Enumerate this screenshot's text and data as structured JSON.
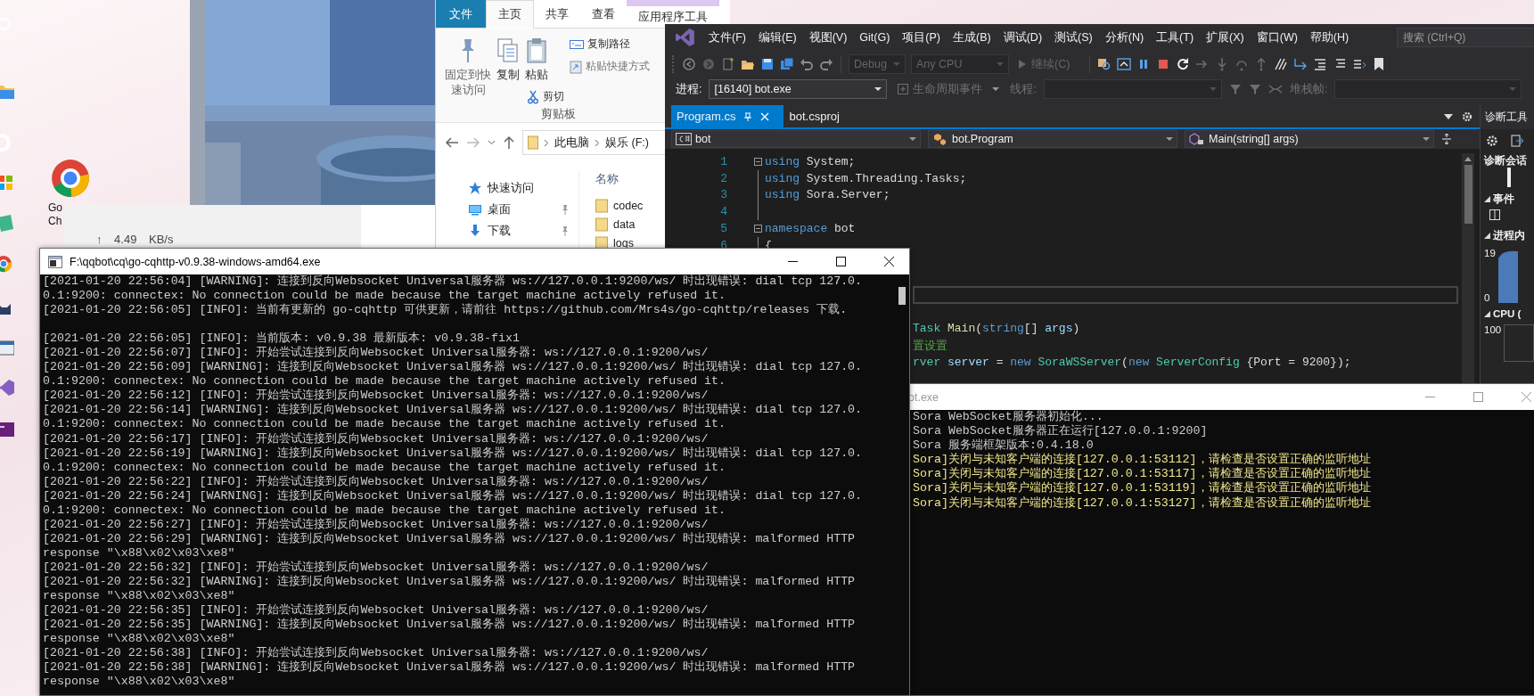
{
  "desktop": {
    "icon_label_lines": [
      "Go",
      "Ch"
    ]
  },
  "network_widget": {
    "text": "↑ 4.49 KB/s"
  },
  "explorer": {
    "tabs": [
      {
        "label": "文件",
        "kind": "file",
        "selected": false
      },
      {
        "label": "主页",
        "kind": "tab",
        "selected": true
      },
      {
        "label": "共享",
        "kind": "tab",
        "selected": false
      },
      {
        "label": "查看",
        "kind": "tab",
        "selected": false
      },
      {
        "label": "应用程序工具",
        "kind": "context",
        "selected": false
      }
    ],
    "ribbon": {
      "pin": "固定到快速访问",
      "copy": "复制",
      "paste": "粘贴",
      "cut": "剪切",
      "copy_path": "复制路径",
      "paste_shortcut": "粘贴快捷方式",
      "group": "剪贴板"
    },
    "address": [
      "此电脑",
      "娱乐 (F:)"
    ],
    "nav_items": [
      {
        "label": "快速访问",
        "kind": "star",
        "pinned": false
      },
      {
        "label": "桌面",
        "kind": "desktop",
        "pinned": true
      },
      {
        "label": "下载",
        "kind": "download",
        "pinned": true
      }
    ],
    "column": "名称",
    "files": [
      "codec",
      "data",
      "logs"
    ]
  },
  "visual_studio": {
    "menus": [
      "文件(F)",
      "编辑(E)",
      "视图(V)",
      "Git(G)",
      "项目(P)",
      "生成(B)",
      "调试(D)",
      "测试(S)",
      "分析(N)",
      "工具(T)",
      "扩展(X)",
      "窗口(W)",
      "帮助(H)"
    ],
    "search": {
      "placeholder": "搜索 (Ctrl+Q)"
    },
    "toolbar": {
      "configuration": {
        "value": "Debug",
        "disabled": true
      },
      "platform": {
        "value": "Any CPU",
        "disabled": true
      },
      "continue": {
        "label": "继续(C)",
        "disabled": true
      }
    },
    "debug_bar": [
      {
        "kind": "label",
        "text": "进程:",
        "disabled": false
      },
      {
        "kind": "dropdown",
        "value": "[16140] bot.exe",
        "disabled": false
      },
      {
        "kind": "button",
        "text": "生命周期事件",
        "disabled": true
      },
      {
        "kind": "label",
        "text": "线程:",
        "disabled": true
      },
      {
        "kind": "dropdown",
        "disabled": true
      },
      {
        "kind": "filters",
        "disabled": true
      },
      {
        "kind": "label",
        "text": "堆栈帧:",
        "disabled": true
      },
      {
        "kind": "dropdown",
        "disabled": true
      }
    ],
    "doc_tabs": [
      {
        "label": "Program.cs",
        "selected": true
      },
      {
        "label": "bot.csproj",
        "selected": false
      }
    ],
    "nav_bar": [
      "bot",
      "bot.Program",
      "Main(string[] args)"
    ],
    "editor": {
      "lines": [
        {
          "number": "1",
          "fold": true,
          "tokens": [
            {
              "text": "using",
              "kind": "keyword"
            },
            {
              "text": " System;",
              "kind": "plain"
            }
          ]
        },
        {
          "number": "2",
          "fold": false,
          "tokens": [
            {
              "text": "using",
              "kind": "keyword"
            },
            {
              "text": " System.Threading.Tasks;",
              "kind": "plain"
            }
          ]
        },
        {
          "number": "3",
          "fold": false,
          "tokens": [
            {
              "text": "using",
              "kind": "keyword"
            },
            {
              "text": " Sora.Server;",
              "kind": "plain"
            }
          ]
        },
        {
          "number": "4",
          "fold": false
        },
        {
          "number": "5",
          "fold": true,
          "tokens": [
            {
              "text": "namespace",
              "kind": "keyword"
            },
            {
              "text": " bot",
              "kind": "plain"
            }
          ]
        },
        {
          "number": "6",
          "fold": false,
          "tokens": [
            {
              "text": "{",
              "kind": "plain"
            }
          ]
        }
      ],
      "current_line": true,
      "partial_lines": [
        {
          "tokens": [
            {
              "text": "Task",
              "kind": "type"
            },
            {
              "text": " Main",
              "kind": "method"
            },
            {
              "text": "(",
              "kind": "plain"
            },
            {
              "text": "string",
              "kind": "keyword"
            },
            {
              "text": "[] ",
              "kind": "plain"
            },
            {
              "text": "args",
              "kind": "param"
            },
            {
              "text": ")",
              "kind": "plain"
            }
          ]
        },
        {
          "tokens": [
            {
              "text": "置设置",
              "kind": "comment"
            }
          ]
        },
        {
          "tokens": [
            {
              "text": "rver",
              "kind": "type"
            },
            {
              "text": " server",
              "kind": "param"
            },
            {
              "text": " = ",
              "kind": "plain"
            },
            {
              "text": "new",
              "kind": "keyword"
            },
            {
              "text": " SoraWSServer",
              "kind": "type"
            },
            {
              "text": "(",
              "kind": "plain"
            },
            {
              "text": "new",
              "kind": "keyword"
            },
            {
              "text": " ServerConfig",
              "kind": "type"
            },
            {
              "text": " {Port = 9200});",
              "kind": "plain"
            }
          ]
        }
      ]
    },
    "diagnostics": {
      "title": "诊断工具",
      "session": "诊断会话",
      "events": "事件",
      "memory": "进程内",
      "memory_ticks": [
        "19",
        "0"
      ],
      "cpu": "CPU (",
      "cpu_ticks": [
        "100"
      ]
    }
  },
  "console_go": {
    "title": "F:\\qqbot\\cq\\go-cqhttp-v0.9.38-windows-amd64.exe",
    "lines": [
      {
        "text": "[2021-01-20 22:56:04] [WARNING]: 连接到反向Websocket Universal服务器 ws://127.0.0.1:9200/ws/ 时出现错误: dial tcp 127.0."
      },
      {
        "text": "0.1:9200: connectex: No connection could be made because the target machine actively refused it."
      },
      {
        "text": "[2021-01-20 22:56:05] [INFO]: 当前有更新的 go-cqhttp 可供更新，请前往 https://github.com/Mrs4s/go-cqhttp/releases 下载."
      },
      {
        "text": "[2021-01-20 22:56:05] [INFO]: 当前版本: v0.9.38 最新版本: v0.9.38-fix1",
        "blank_before": true
      },
      {
        "text": "[2021-01-20 22:56:07] [INFO]: 开始尝试连接到反向Websocket Universal服务器: ws://127.0.0.1:9200/ws/"
      },
      {
        "text": "[2021-01-20 22:56:09] [WARNING]: 连接到反向Websocket Universal服务器 ws://127.0.0.1:9200/ws/ 时出现错误: dial tcp 127.0."
      },
      {
        "text": "0.1:9200: connectex: No connection could be made because the target machine actively refused it."
      },
      {
        "text": "[2021-01-20 22:56:12] [INFO]: 开始尝试连接到反向Websocket Universal服务器: ws://127.0.0.1:9200/ws/"
      },
      {
        "text": "[2021-01-20 22:56:14] [WARNING]: 连接到反向Websocket Universal服务器 ws://127.0.0.1:9200/ws/ 时出现错误: dial tcp 127.0."
      },
      {
        "text": "0.1:9200: connectex: No connection could be made because the target machine actively refused it."
      },
      {
        "text": "[2021-01-20 22:56:17] [INFO]: 开始尝试连接到反向Websocket Universal服务器: ws://127.0.0.1:9200/ws/"
      },
      {
        "text": "[2021-01-20 22:56:19] [WARNING]: 连接到反向Websocket Universal服务器 ws://127.0.0.1:9200/ws/ 时出现错误: dial tcp 127.0."
      },
      {
        "text": "0.1:9200: connectex: No connection could be made because the target machine actively refused it."
      },
      {
        "text": "[2021-01-20 22:56:22] [INFO]: 开始尝试连接到反向Websocket Universal服务器: ws://127.0.0.1:9200/ws/"
      },
      {
        "text": "[2021-01-20 22:56:24] [WARNING]: 连接到反向Websocket Universal服务器 ws://127.0.0.1:9200/ws/ 时出现错误: dial tcp 127.0."
      },
      {
        "text": "0.1:9200: connectex: No connection could be made because the target machine actively refused it."
      },
      {
        "text": "[2021-01-20 22:56:27] [INFO]: 开始尝试连接到反向Websocket Universal服务器: ws://127.0.0.1:9200/ws/"
      },
      {
        "text": "[2021-01-20 22:56:29] [WARNING]: 连接到反向Websocket Universal服务器 ws://127.0.0.1:9200/ws/ 时出现错误: malformed HTTP"
      },
      {
        "text": "response \"\\x88\\x02\\x03\\xe8\""
      },
      {
        "text": "[2021-01-20 22:56:32] [INFO]: 开始尝试连接到反向Websocket Universal服务器: ws://127.0.0.1:9200/ws/"
      },
      {
        "text": "[2021-01-20 22:56:32] [WARNING]: 连接到反向Websocket Universal服务器 ws://127.0.0.1:9200/ws/ 时出现错误: malformed HTTP"
      },
      {
        "text": "response \"\\x88\\x02\\x03\\xe8\""
      },
      {
        "text": "[2021-01-20 22:56:35] [INFO]: 开始尝试连接到反向Websocket Universal服务器: ws://127.0.0.1:9200/ws/"
      },
      {
        "text": "[2021-01-20 22:56:35] [WARNING]: 连接到反向Websocket Universal服务器 ws://127.0.0.1:9200/ws/ 时出现错误: malformed HTTP"
      },
      {
        "text": "response \"\\x88\\x02\\x03\\xe8\""
      },
      {
        "text": "[2021-01-20 22:56:38] [INFO]: 开始尝试连接到反向Websocket Universal服务器: ws://127.0.0.1:9200/ws/"
      },
      {
        "text": "[2021-01-20 22:56:38] [WARNING]: 连接到反向Websocket Universal服务器 ws://127.0.0.1:9200/ws/ 时出现错误: malformed HTTP"
      },
      {
        "text": "response \"\\x88\\x02\\x03\\xe8\""
      }
    ]
  },
  "console_bot": {
    "title": "ot.exe",
    "lines": [
      {
        "text": "Sora WebSocket服务器初始化...",
        "color": "#cccccc"
      },
      {
        "text": "Sora WebSocket服务器正在运行[127.0.0.1:9200]",
        "color": "#cccccc"
      },
      {
        "text": "Sora 服务端框架版本:0.4.18.0",
        "color": "#cccccc"
      },
      {
        "text": "Sora]关闭与未知客户端的连接[127.0.0.1:53112]，请检查是否设置正确的监听地址",
        "color": "#f0e68c"
      },
      {
        "text": "Sora]关闭与未知客户端的连接[127.0.0.1:53117]，请检查是否设置正确的监听地址",
        "color": "#f0e68c"
      },
      {
        "text": "Sora]关闭与未知客户端的连接[127.0.0.1:53119]，请检查是否设置正确的监听地址",
        "color": "#f0e68c"
      },
      {
        "text": "Sora]关闭与未知客户端的连接[127.0.0.1:53127]，请检查是否设置正确的监听地址",
        "color": "#f0e68c"
      }
    ]
  }
}
